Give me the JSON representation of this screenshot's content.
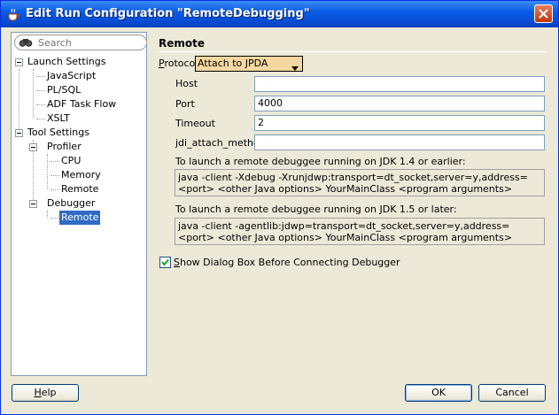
{
  "window": {
    "title": "Edit Run Configuration \"RemoteDebugging\"",
    "app_icon": "java-cup-icon",
    "close_icon": "close-icon"
  },
  "sidebar": {
    "search_placeholder": "Search",
    "tree": {
      "launch_settings": "Launch Settings",
      "javascript": "JavaScript",
      "plsql": "PL/SQL",
      "adf_task_flow": "ADF Task Flow",
      "xslt": "XSLT",
      "tool_settings": "Tool Settings",
      "profiler": "Profiler",
      "cpu": "CPU",
      "memory": "Memory",
      "profiler_remote": "Remote",
      "debugger": "Debugger",
      "debugger_remote": "Remote"
    }
  },
  "main": {
    "title": "Remote",
    "protocol_label_p": "P",
    "protocol_label_rest": "rotocol",
    "protocol_value": "Attach to JPDA",
    "host_label": "Host",
    "host_value": "",
    "port_label": "Port",
    "port_value": "4000",
    "timeout_label": "Timeout",
    "timeout_value": "2",
    "jdi_label": "jdi_attach_method:",
    "jdi_value": "",
    "jdk14_label": "To launch a remote debuggee running on JDK 1.4 or earlier:",
    "jdk14_cmd": "java -client -Xdebug -Xrunjdwp:transport=dt_socket,server=y,address=<port> <other Java options> YourMainClass <program arguments>",
    "jdk15_label": "To launch a remote debuggee running on JDK 1.5 or later:",
    "jdk15_cmd": "java -client -agentlib:jdwp=transport=dt_socket,server=y,address=<port> <other Java options> YourMainClass <program arguments>",
    "show_dialog_label_s": "S",
    "show_dialog_label_rest": "how Dialog Box Before Connecting Debugger",
    "show_dialog_checked": true
  },
  "footer": {
    "help_h": "H",
    "help_rest": "elp",
    "ok": "OK",
    "cancel": "Cancel"
  },
  "colors": {
    "titlebar": "#0a5ce6",
    "selection": "#316ac5",
    "combo_bg": "#f5d7a1",
    "dialog_bg": "#ece9d8"
  }
}
